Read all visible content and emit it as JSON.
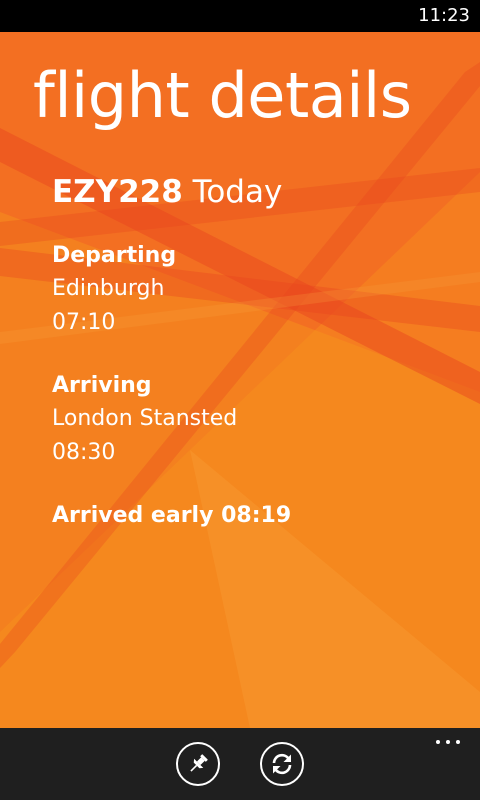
{
  "status_bar": {
    "time": "11:23"
  },
  "page": {
    "title": "flight details"
  },
  "flight": {
    "number": "EZY228",
    "day": "Today",
    "departing": {
      "label": "Departing",
      "city": "Edinburgh",
      "time": "07:10"
    },
    "arriving": {
      "label": "Arriving",
      "city": "London Stansted",
      "time": "08:30"
    },
    "status": "Arrived early 08:19"
  },
  "app_bar": {
    "buttons": [
      {
        "icon": "pin-icon"
      },
      {
        "icon": "refresh-icon"
      }
    ],
    "more_icon": "ellipsis-icon"
  },
  "colors": {
    "background": "#f36f22",
    "stripe_light": "#f7941d",
    "stripe_dark": "#e8421f",
    "app_bar": "#1f1f1f",
    "text": "#ffffff"
  }
}
